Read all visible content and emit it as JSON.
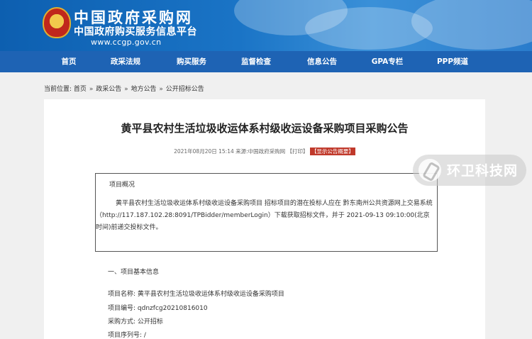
{
  "header": {
    "site_title": "中国政府采购网",
    "site_subtitle": "中国政府购买服务信息平台",
    "site_url": "www.ccgp.gov.cn",
    "bg_color": "#1a74c6"
  },
  "nav": {
    "items": [
      {
        "label": "首页"
      },
      {
        "label": "政采法规"
      },
      {
        "label": "购买服务"
      },
      {
        "label": "监督检查"
      },
      {
        "label": "信息公告"
      },
      {
        "label": "GPA专栏"
      },
      {
        "label": "PPP频道"
      }
    ],
    "bg_color": "#1e63b4"
  },
  "breadcrumb": {
    "prefix": "当前位置:",
    "items": [
      "首页",
      "政采公告",
      "地方公告",
      "公开招标公告"
    ],
    "separator": "»"
  },
  "article": {
    "title": "黄平县农村生活垃圾收运体系村级收运设备采购项目采购公告",
    "meta": {
      "datetime": "2021年08月20日 15:14",
      "source": "来源:中国政府采购网",
      "print": "【打印】",
      "summary_button": "【显示公告概要】"
    },
    "overview": {
      "title": "项目概况",
      "text": "黄平县农村生活垃圾收运体系村级收运设备采购项目 招标项目的潜在投标人应在 黔东南州公共资源网上交易系统（http://117.187.102.28:8091/TPBidder/memberLogin）下载获取招标文件，并于 2021-09-13 09:10:00(北京时间)前递交投标文件。"
    },
    "section1": {
      "heading": "一、项目基本信息",
      "fields": [
        {
          "label": "项目名称:",
          "value": "黄平县农村生活垃圾收运体系村级收运设备采购项目"
        },
        {
          "label": "项目编号:",
          "value": "qdnzfcg20210816010"
        },
        {
          "label": "采购方式:",
          "value": "公开招标"
        },
        {
          "label": "项目序列号:",
          "value": "/"
        }
      ]
    }
  },
  "watermark": {
    "text": "环卫科技网"
  }
}
